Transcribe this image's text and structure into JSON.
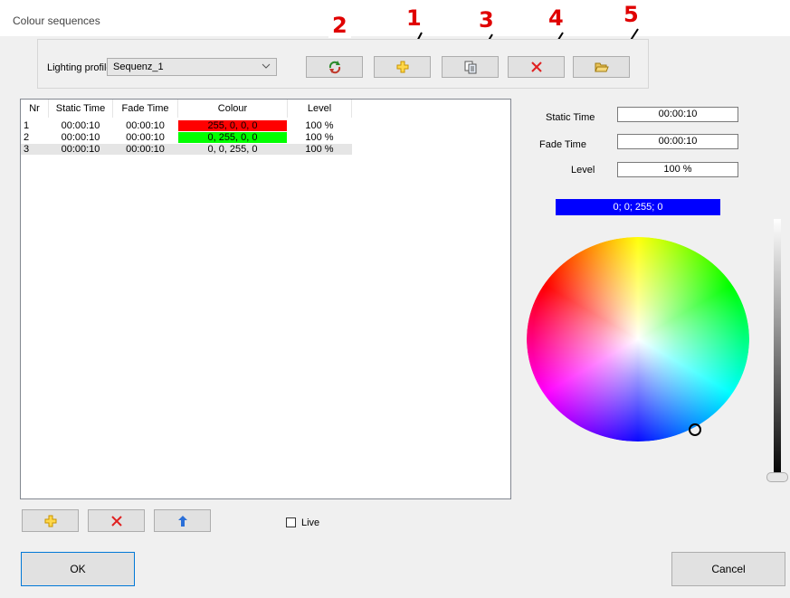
{
  "window": {
    "title": "Colour sequences"
  },
  "toolbar": {
    "profile_label": "Lighting profile",
    "profile_value": "Sequenz_1",
    "annotations": [
      "2",
      "1",
      "3",
      "4",
      "5"
    ]
  },
  "list": {
    "columns": [
      "Nr",
      "Static Time",
      "Fade Time",
      "Colour",
      "Level"
    ],
    "rows": [
      {
        "nr": "1",
        "static": "00:00:10",
        "fade": "00:00:10",
        "colour": "255, 0, 0, 0",
        "level": "100 %",
        "swatch": "#ff0000"
      },
      {
        "nr": "2",
        "static": "00:00:10",
        "fade": "00:00:10",
        "colour": "0, 255, 0, 0",
        "level": "100 %",
        "swatch": "#00ff00"
      },
      {
        "nr": "3",
        "static": "00:00:10",
        "fade": "00:00:10",
        "colour": "0, 0, 255, 0",
        "level": "100 %",
        "swatch": ""
      }
    ]
  },
  "details": {
    "static_label": "Static Time",
    "static_value": "00:00:10",
    "fade_label": "Fade Time",
    "fade_value": "00:00:10",
    "level_label": "Level",
    "level_value": "100 %",
    "colour_value": "0; 0; 255; 0",
    "colour_hex": "#0000ff"
  },
  "live_label": "Live",
  "buttons": {
    "ok": "OK",
    "cancel": "Cancel"
  },
  "colors": {
    "accent_blue": "#0000ff",
    "annotation_red": "#e00000",
    "delete_red": "#e02020"
  }
}
